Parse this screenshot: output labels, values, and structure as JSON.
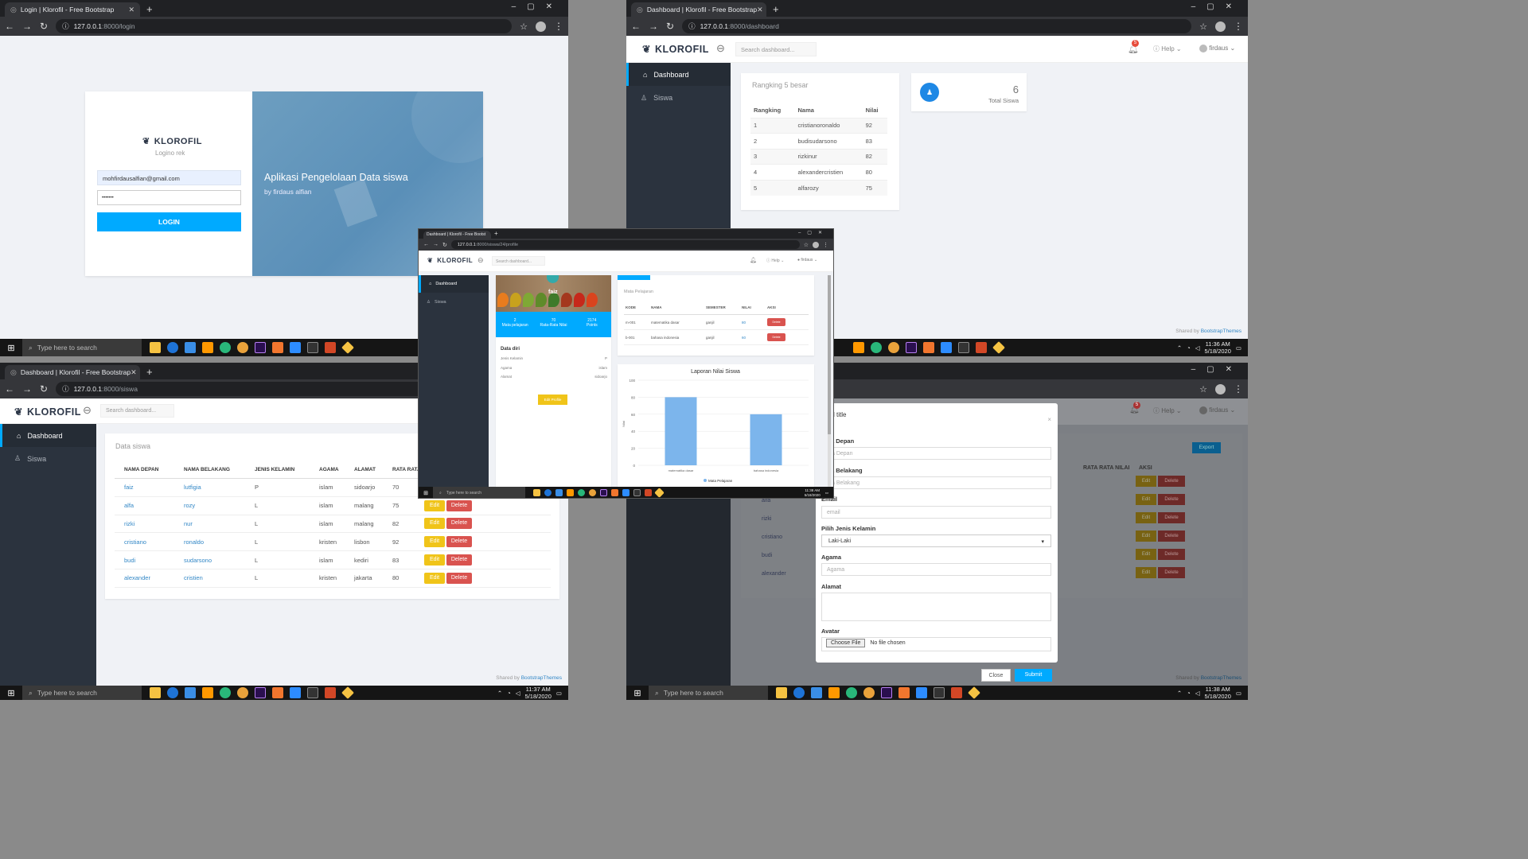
{
  "windows": {
    "login": {
      "tab": "Login | Klorofil - Free Bootstrap",
      "url_host": "127.0.0.1",
      "url_path": ":8000/login",
      "logo": "KLOROFIL",
      "subtitle": "Logino rek",
      "email": "mohfirdausalfian@gmail.com",
      "password": "•••••••",
      "login_btn": "LOGIN",
      "hero_title": "Aplikasi Pengelolaan Data siswa",
      "hero_sub": "by firdaus alfian"
    },
    "dashboard": {
      "tab": "Dashboard | Klorofil - Free Bootstrap",
      "url_host": "127.0.0.1",
      "url_path": ":8000/dashboard",
      "logo": "KLOROFIL",
      "search_placeholder": "Search dashboard...",
      "notif_count": "5",
      "help": "Help",
      "user": "firdaus",
      "menu": [
        "Dashboard",
        "Siswa"
      ],
      "rank_title": "Rangking 5 besar",
      "rank_headers": [
        "Rangking",
        "Nama",
        "Nilai"
      ],
      "rank_rows": [
        [
          "1",
          "cristianoronaldo",
          "92"
        ],
        [
          "2",
          "budisudarsono",
          "83"
        ],
        [
          "3",
          "rizkinur",
          "82"
        ],
        [
          "4",
          "alexandercristien",
          "80"
        ],
        [
          "5",
          "alfarozy",
          "75"
        ]
      ],
      "total_value": "6",
      "total_label": "Total Siswa",
      "footer": "Shared by",
      "footer_link": "BootstrapThemes"
    },
    "siswa": {
      "tab": "Dashboard | Klorofil - Free Bootstrap",
      "url_host": "127.0.0.1",
      "url_path": ":8000/siswa",
      "logo": "KLOROFIL",
      "search_placeholder": "Search dashboard...",
      "menu": [
        "Dashboard",
        "Siswa"
      ],
      "panel_title": "Data siswa",
      "headers": [
        "NAMA DEPAN",
        "NAMA BELAKANG",
        "JENIS KELAMIN",
        "AGAMA",
        "ALAMAT",
        "RATA RATA"
      ],
      "rows": [
        [
          "faiz",
          "lutfigia",
          "P",
          "islam",
          "sidoarjo",
          "70"
        ],
        [
          "alfa",
          "rozy",
          "L",
          "islam",
          "malang",
          "75"
        ],
        [
          "rizki",
          "nur",
          "L",
          "islam",
          "malang",
          "82"
        ],
        [
          "cristiano",
          "ronaldo",
          "L",
          "kristen",
          "lisbon",
          "92"
        ],
        [
          "budi",
          "sudarsono",
          "L",
          "islam",
          "kediri",
          "83"
        ],
        [
          "alexander",
          "cristien",
          "L",
          "kristen",
          "jakarta",
          "80"
        ]
      ],
      "edit": "Edit",
      "delete": "Delete",
      "footer": "Shared by",
      "footer_link": "BootstrapThemes"
    },
    "profile": {
      "tab": "Dashboard | Klorofil - Free Bootst",
      "url_host": "127.0.0.1",
      "url_path": ":8000/siswa/24/profile",
      "logo": "KLOROFIL",
      "search_placeholder": "Search dashboard...",
      "help": "Help",
      "user": "firdaus",
      "menu": [
        "Dashboard",
        "Siswa"
      ],
      "name": "faiz",
      "stats": [
        {
          "value": "2",
          "label": "Mata pelajaran"
        },
        {
          "value": "70",
          "label": "Rata-Rata Nilai"
        },
        {
          "value": "2174",
          "label": "Points"
        }
      ],
      "data_diri_title": "Data diri",
      "data_diri": [
        [
          "Jenis Kelamin",
          "P"
        ],
        [
          "Agama",
          "islam"
        ],
        [
          "Alamat",
          "sidoarjo"
        ]
      ],
      "edit_profile": "Edit Profile",
      "mapel_title": "Mata Pelajaran",
      "mapel_headers": [
        "KODE",
        "NAMA",
        "SEMESTER",
        "NILAI",
        "AKSI"
      ],
      "mapel_rows": [
        [
          "m-001",
          "matematika dasar",
          "ganjil",
          "80"
        ],
        [
          "b-001",
          "bahasa indonesia",
          "ganjil",
          "60"
        ]
      ],
      "delete": "Delete",
      "chart_title": "Laporan Nilai Siswa"
    },
    "modal": {
      "export": "Export",
      "modal_title": "l title",
      "fields": [
        {
          "label": "a Depan",
          "placeholder": "a Depan"
        },
        {
          "label": "a Belakang",
          "placeholder": "a Belakang"
        },
        {
          "label": "Email",
          "placeholder": "email"
        }
      ],
      "gender_label": "Pilih Jenis Kelamin",
      "gender_value": "Laki-Laki",
      "agama_label": "Agama",
      "agama_placeholder": "Agama",
      "alamat_label": "Alamat",
      "avatar_label": "Avatar",
      "choose_file": "Choose File",
      "no_file": "No file chosen",
      "close": "Close",
      "submit": "Submit",
      "bg_headers": [
        "RATA RATA NILAI",
        "AKSI"
      ],
      "bg_names": [
        "alfa",
        "rizki",
        "cristiano",
        "budi",
        "alexander"
      ],
      "help": "Help",
      "user": "firdaus",
      "notif_count": "5",
      "footer": "Shared by",
      "footer_link": "BootstrapThemes"
    }
  },
  "taskbar": {
    "search": "Type here to search",
    "time_tr": "11:36 AM",
    "date_tr": "5/18/2020",
    "time_bl": "11:37 AM",
    "date_bl": "5/18/2020",
    "time_br": "11:38 AM",
    "date_br": "5/18/2020",
    "time_c": "11:38 AM",
    "date_c": "5/18/2020"
  },
  "chart_data": {
    "type": "bar",
    "title": "Laporan Nilai Siswa",
    "categories": [
      "matematika dasar",
      "bahasa indonesia"
    ],
    "series": [
      {
        "name": "Mata Pelajaran",
        "values": [
          80,
          60
        ]
      }
    ],
    "ylabel": "Nilai",
    "ylim": [
      0,
      100
    ],
    "yticks": [
      "0",
      "20",
      "40",
      "60",
      "80",
      "100"
    ],
    "color": "#7cb5ec"
  }
}
